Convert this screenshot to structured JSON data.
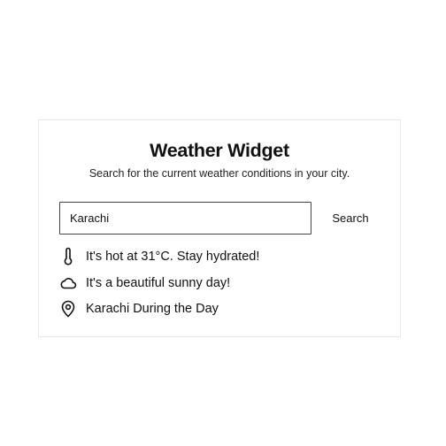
{
  "widget": {
    "title": "Weather Widget",
    "subtitle": "Search for the current weather conditions in your city.",
    "search": {
      "value": "Karachi",
      "placeholder": "",
      "button_label": "Search"
    },
    "info": [
      {
        "icon": "thermometer-icon",
        "text": "It's hot at 31°C. Stay hydrated!"
      },
      {
        "icon": "cloud-icon",
        "text": "It's a beautiful sunny day!"
      },
      {
        "icon": "map-pin-icon",
        "text": "Karachi During the Day"
      }
    ]
  },
  "colors": {
    "text": "#111111",
    "card_border": "#e7e7e7",
    "input_border": "#444444",
    "background": "#ffffff"
  }
}
